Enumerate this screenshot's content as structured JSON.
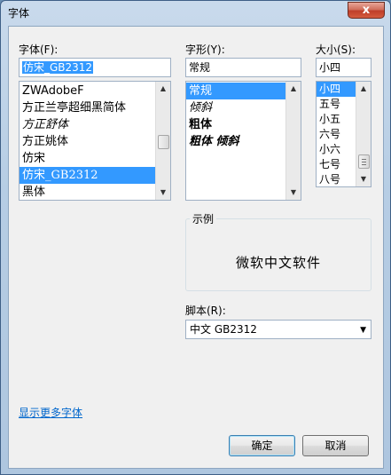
{
  "window": {
    "title": "字体",
    "close_label": "x"
  },
  "font_family": {
    "label": "字体(F):",
    "value": "仿宋_GB2312",
    "items": [
      "ZWAdobeF",
      "方正兰亭超细黑简体",
      "方正舒体",
      "方正姚体",
      "仿宋",
      "仿宋_GB2312",
      "黑体"
    ],
    "selected_index": 5
  },
  "font_style": {
    "label": "字形(Y):",
    "value": "常规",
    "items": [
      "常规",
      "倾斜",
      "粗体",
      "粗体 倾斜"
    ],
    "selected_index": 0
  },
  "font_size": {
    "label": "大小(S):",
    "value": "小四",
    "items": [
      "小四",
      "五号",
      "小五",
      "六号",
      "小六",
      "七号",
      "八号"
    ],
    "selected_index": 0
  },
  "sample": {
    "label": "示例",
    "text": "微软中文软件"
  },
  "script": {
    "label": "脚本(R):",
    "value": "中文 GB2312"
  },
  "more_fonts_link": "显示更多字体",
  "buttons": {
    "ok": "确定",
    "cancel": "取消"
  }
}
